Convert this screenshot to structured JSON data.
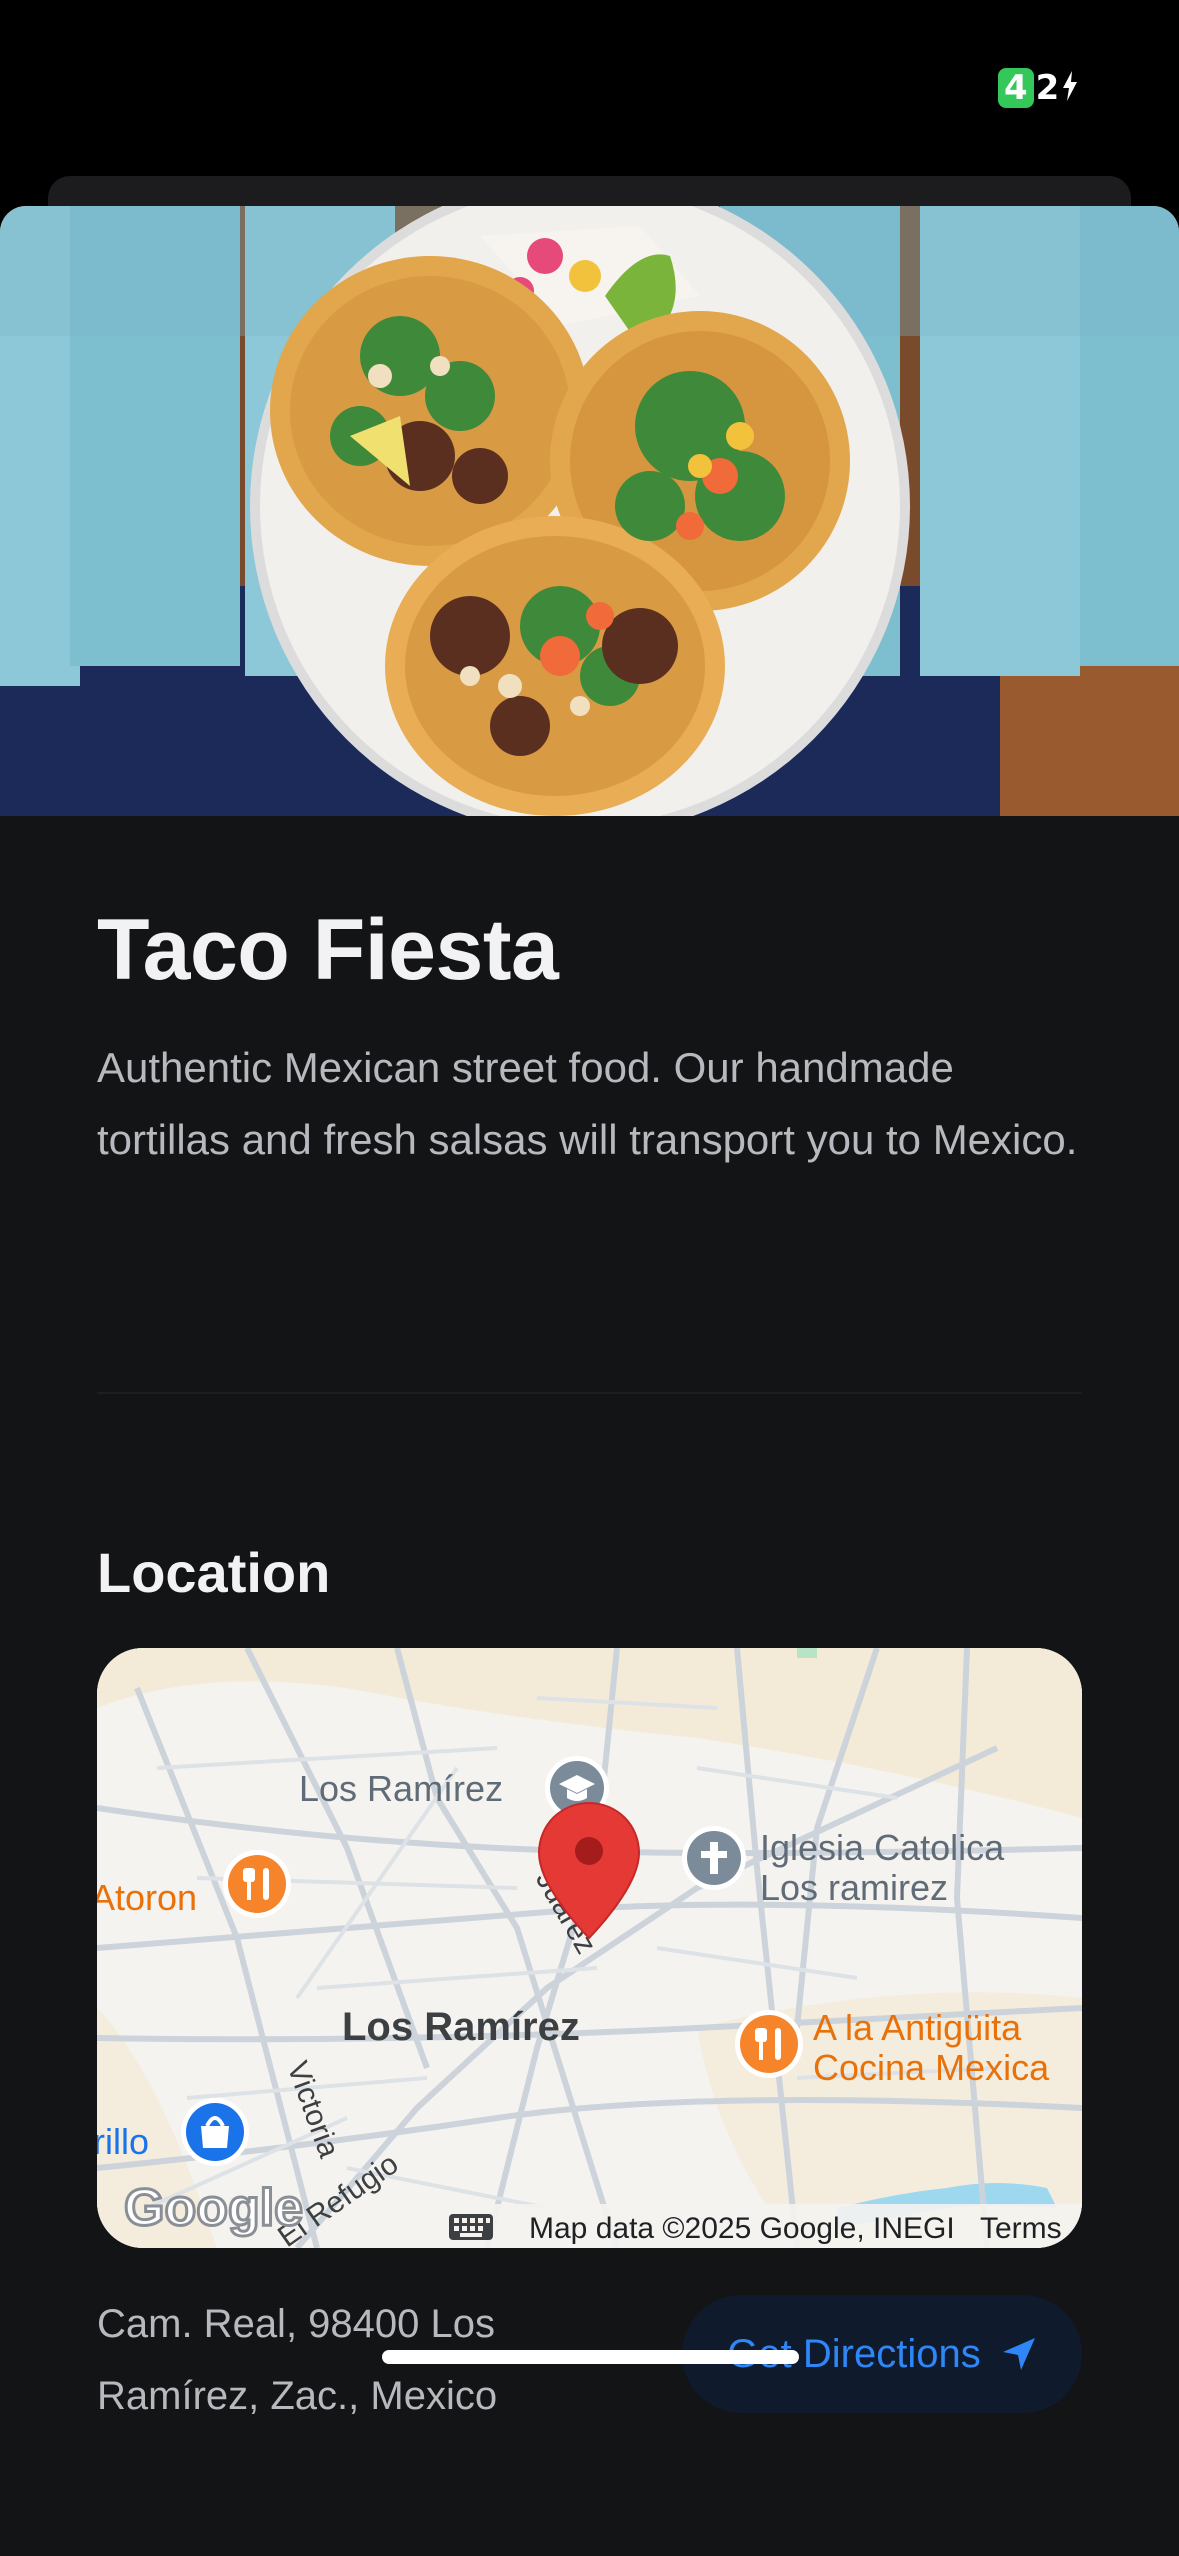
{
  "status_bar": {
    "battery_level": "4",
    "battery_rest": "2"
  },
  "restaurant": {
    "name": "Taco Fiesta",
    "description": "Authentic Mexican street food. Our handmade tortillas and fresh salsas will transport you to Mexico."
  },
  "location": {
    "section_title": "Location",
    "address": "Cam. Real, 98400 Los Ramírez, Zac., Mexico",
    "directions_label": "Get Directions",
    "map": {
      "labels": {
        "school": "Los Ramírez",
        "church_line1": "Iglesia Catolica",
        "church_line2": "Los ramirez",
        "restaurant_left": "Atoron",
        "town": "Los Ramírez",
        "street_juarez": "Juárez",
        "street_victoria": "Victoria",
        "street_refugio": "El Refugio",
        "restaurant_right_line1": "A la Antigüita",
        "restaurant_right_line2": "Cocina Mexica",
        "shop_left": "rillo",
        "google_logo": "Google",
        "attribution": "Map data ©2025 Google, INEGI",
        "terms": "Terms"
      },
      "colors": {
        "restaurant_pin": "#f5842a",
        "school_pin": "#7c8b99",
        "shop_pin": "#1a73e8",
        "location_pin": "#e53935",
        "restaurant_text": "#e8710a",
        "shop_text": "#1a73e8"
      }
    }
  },
  "theme": {
    "background": "#131416",
    "accent": "#2f86f6",
    "button_bg": "#0f1a2c"
  }
}
